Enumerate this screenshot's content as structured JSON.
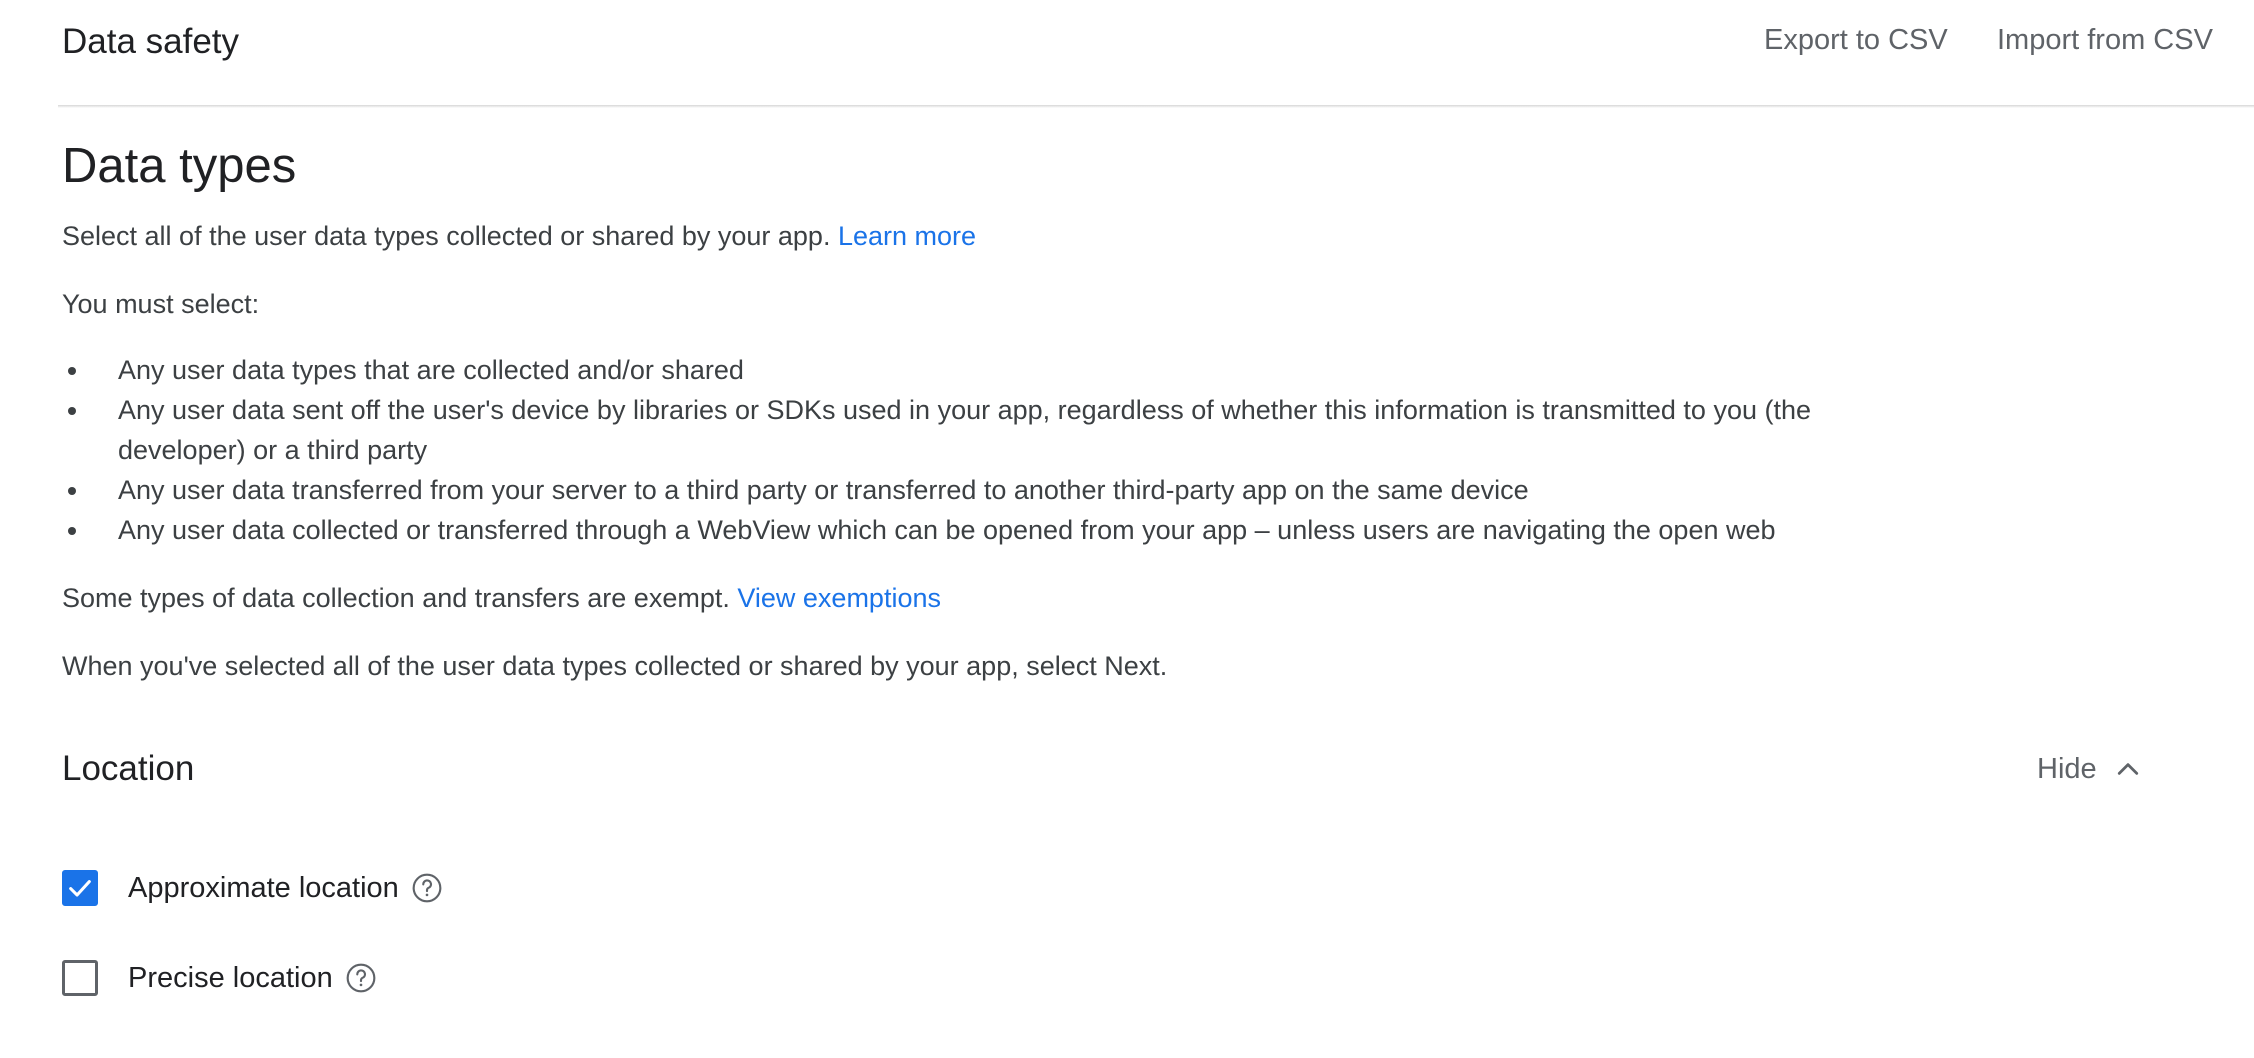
{
  "header": {
    "title": "Data safety",
    "export_label": "Export to CSV",
    "import_label": "Import from CSV"
  },
  "data_types": {
    "heading": "Data types",
    "intro_text": "Select all of the user data types collected or shared by your app.",
    "learn_more_label": "Learn more",
    "must_select_text": "You must select:",
    "requirements": [
      "Any user data types that are collected and/or shared",
      "Any user data sent off the user's device by libraries or SDKs used in your app, regardless of whether this information is transmitted to you (the developer) or a third party",
      "Any user data transferred from your server to a third party or transferred to another third-party app on the same device",
      "Any user data collected or transferred through a WebView which can be opened from your app – unless users are navigating the open web"
    ],
    "exempt_text": "Some types of data collection and transfers are exempt.",
    "view_exemptions_label": "View exemptions",
    "next_instruction": "When you've selected all of the user data types collected or shared by your app, select Next."
  },
  "location_section": {
    "title": "Location",
    "toggle_label": "Hide",
    "items": [
      {
        "label": "Approximate location",
        "checked": true
      },
      {
        "label": "Precise location",
        "checked": false
      }
    ]
  },
  "colors": {
    "accent": "#1a73e8",
    "text_primary": "#202124",
    "text_secondary": "#3c4043",
    "text_muted": "#5f6368"
  },
  "icons": {
    "toggle": "chevron-up-icon",
    "help": "help-circle-icon",
    "check": "checkmark-icon"
  }
}
